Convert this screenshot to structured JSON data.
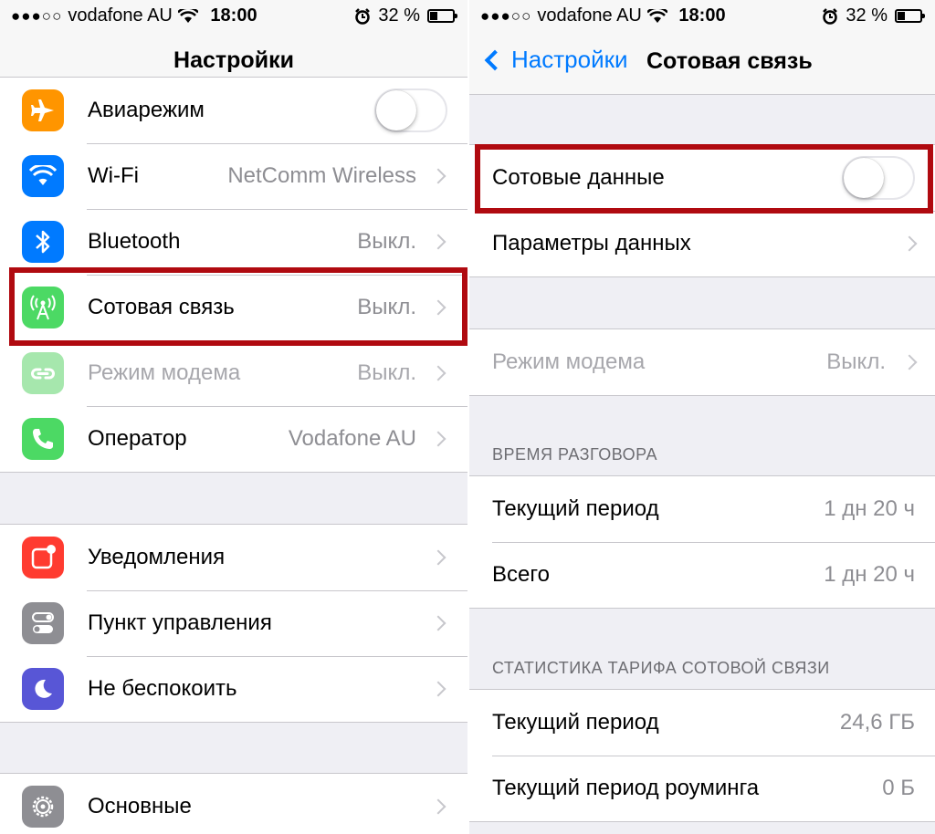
{
  "status_bar": {
    "carrier": "vodafone AU",
    "time": "18:00",
    "battery": "32 %",
    "battery_level": 0.32
  },
  "left": {
    "title": "Настройки",
    "group1": [
      {
        "label": "Авиарежим",
        "icon": "airplane-icon",
        "color": "#ff9500",
        "toggle": false
      },
      {
        "label": "Wi-Fi",
        "value": "NetComm Wireless",
        "icon": "wifi-icon",
        "color": "#007aff"
      },
      {
        "label": "Bluetooth",
        "value": "Выкл.",
        "icon": "bluetooth-icon",
        "color": "#007aff"
      },
      {
        "label": "Сотовая связь",
        "value": "Выкл.",
        "icon": "cellular-antenna-icon",
        "color": "#4cd964"
      },
      {
        "label": "Режим модема",
        "value": "Выкл.",
        "icon": "hotspot-chain-icon",
        "color": "#a6e7ad"
      },
      {
        "label": "Оператор",
        "value": "Vodafone AU",
        "icon": "phone-icon",
        "color": "#4cd964"
      }
    ],
    "group2": [
      {
        "label": "Уведомления",
        "icon": "notifications-icon",
        "color": "#ff3b30"
      },
      {
        "label": "Пункт управления",
        "icon": "control-center-icon",
        "color": "#8e8e93"
      },
      {
        "label": "Не беспокоить",
        "icon": "moon-icon",
        "color": "#5856d6"
      }
    ],
    "group3": [
      {
        "label": "Основные",
        "icon": "gear-icon",
        "color": "#8e8e93"
      }
    ]
  },
  "right": {
    "back_label": "Настройки",
    "title": "Сотовая связь",
    "cellular_data": {
      "label": "Сотовые данные",
      "toggle": false
    },
    "data_options": {
      "label": "Параметры данных"
    },
    "hotspot": {
      "label": "Режим модема",
      "value": "Выкл."
    },
    "call_time_header": "ВРЕМЯ РАЗГОВОРА",
    "call_time": [
      {
        "label": "Текущий период",
        "value": "1 дн 20 ч"
      },
      {
        "label": "Всего",
        "value": "1 дн 20 ч"
      }
    ],
    "usage_header": "СТАТИСТИКА ТАРИФА СОТОВОЙ СВЯЗИ",
    "usage": [
      {
        "label": "Текущий период",
        "value": "24,6 ГБ"
      },
      {
        "label": "Текущий период роуминга",
        "value": "0 Б"
      }
    ]
  },
  "highlight_color": "#b00a10"
}
